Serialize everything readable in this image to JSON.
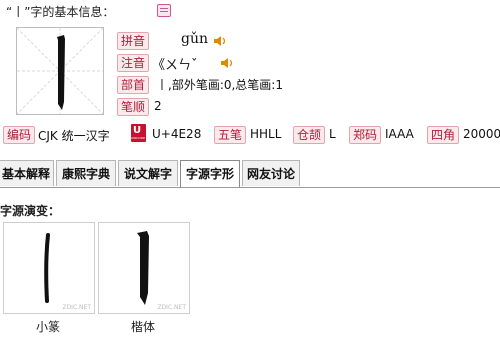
{
  "header": {
    "title": "“丨”字的基本信息："
  },
  "info": {
    "pinyin_label": "拼音",
    "pinyin": "gǔn",
    "zhuyin_label": "注音",
    "zhuyin": "《ㄨㄣˇ",
    "radical_label": "部首",
    "radical": "丨,部外笔画:0,总笔画:1",
    "stroke_order_label": "笔顺",
    "stroke_order": "2"
  },
  "codes": [
    {
      "label": "编码",
      "value": "CJK 统一汉字"
    },
    {
      "label": "UNICODE",
      "value": "U+4E28"
    },
    {
      "label": "五笔",
      "value": "HHLL"
    },
    {
      "label": "仓颉",
      "value": "L"
    },
    {
      "label": "郑码",
      "value": "IAAA"
    },
    {
      "label": "四角",
      "value": "20000"
    }
  ],
  "tabs": [
    {
      "label": "基本解释"
    },
    {
      "label": "康熙字典"
    },
    {
      "label": "说文解字"
    },
    {
      "label": "字源字形"
    },
    {
      "label": "网友讨论"
    }
  ],
  "active_tab": "字源字形",
  "section_title": "字源演变：",
  "glyphs": [
    {
      "label": "小篆",
      "watermark": "ZDIC.NET"
    },
    {
      "label": "楷体",
      "watermark": "ZDIC.NET"
    }
  ]
}
